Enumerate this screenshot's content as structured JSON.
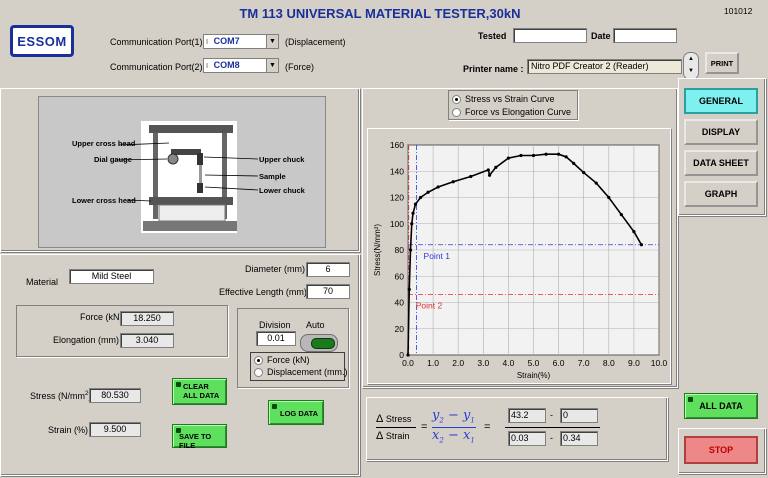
{
  "header": {
    "title": "TM 113 UNIVERSAL MATERIAL TESTER,30kN",
    "code": "101012",
    "logo_text": "ESSOM"
  },
  "ports": {
    "port1_label": "Communication Port(1)",
    "port1_value": "COM7",
    "port1_suffix": "(Displacement)",
    "port2_label": "Communication Port(2)",
    "port2_value": "COM8",
    "port2_suffix": "(Force)"
  },
  "meta": {
    "tested_label": "Tested",
    "tested_value": "",
    "date_label": "Date",
    "date_value": "",
    "printer_label": "Printer name :",
    "printer_value": "Nitro PDF Creator 2 (Reader)",
    "print_button": "PRINT"
  },
  "nav": {
    "general": "GENERAL",
    "display": "DISPLAY",
    "data_sheet": "DATA SHEET",
    "graph": "GRAPH",
    "all_data": "ALL DATA",
    "stop": "STOP"
  },
  "diagram": {
    "upper_cross_head": "Upper cross head",
    "dial_gauge": "Dial gauge",
    "upper_chuck": "Upper chuck",
    "sample": "Sample",
    "lower_chuck": "Lower chuck",
    "lower_cross_head": "Lower cross head"
  },
  "specimen": {
    "material_label": "Material",
    "material_value": "Mild Steel",
    "diameter_label": "Diameter (mm)",
    "diameter_value": "6",
    "length_label": "Effective Length (mm)",
    "length_value": "70"
  },
  "readings": {
    "force_label": "Force (kN)",
    "force_value": "18.250",
    "elongation_label": "Elongation (mm)",
    "elongation_value": "3.040",
    "stress_label": "Stress (N/mm",
    "stress_sup": "2",
    "stress_close": ")",
    "stress_value": "80.530",
    "strain_label": "Strain (%)",
    "strain_value": "9.500"
  },
  "controls": {
    "clear_all": "CLEAR ALL DATA",
    "save_file": "SAVE TO FILE",
    "log_data": "LOG DATA",
    "division_label": "Division",
    "division_value": "0.01",
    "auto_label": "Auto",
    "opt_force": "Force (kN)",
    "opt_disp": "Displacement (mm.)"
  },
  "curve_select": {
    "stress_strain": "Stress vs Strain Curve",
    "force_elong": "Force vs Elongation Curve"
  },
  "formula": {
    "d_stress": "Stress",
    "d_strain": "Strain",
    "delta": "Δ",
    "eq": "=",
    "x2": "x",
    "x1": "x",
    "y2": "y",
    "y1": "y",
    "sub2": "2",
    "sub1": "1",
    "minus": "−",
    "y2_value": "43.2",
    "y1_value": "0",
    "x2_value": "0.03",
    "x1_value": "0.34",
    "dash": "-"
  },
  "chart_data": {
    "type": "line",
    "xlabel": "Strain(%)",
    "ylabel": "Stress(N/mm²)",
    "xlim": [
      0,
      10
    ],
    "ylim": [
      0,
      160
    ],
    "x_ticks": [
      "0.0",
      "1.0",
      "2.0",
      "3.0",
      "4.0",
      "5.0",
      "6.0",
      "7.0",
      "8.0",
      "9.0",
      "10.0"
    ],
    "y_ticks": [
      "0",
      "20",
      "40",
      "60",
      "80",
      "100",
      "120",
      "140",
      "160"
    ],
    "grid": true,
    "series": [
      {
        "x": [
          0,
          0.05,
          0.1,
          0.15,
          0.2,
          0.3,
          0.5,
          0.8,
          1.2,
          1.8,
          2.5,
          3.2,
          3.25,
          3.5,
          4.0,
          4.5,
          5.0,
          5.5,
          6.0,
          6.3,
          6.6,
          7.0,
          7.5,
          8.0,
          8.5,
          9.0,
          9.3
        ],
        "y": [
          0,
          50,
          80,
          100,
          108,
          115,
          120,
          124,
          128,
          132,
          136,
          141,
          137,
          143,
          150,
          152,
          152,
          153,
          153,
          151,
          146,
          139,
          131,
          120,
          107,
          94,
          84
        ],
        "color": "#000000"
      }
    ],
    "markers": [
      {
        "label": "Point 1",
        "x": 0.34,
        "y": 84,
        "color": "#2b3bd8"
      },
      {
        "label": "Point 2",
        "x": 0.03,
        "y": 46,
        "color": "#e03030"
      }
    ]
  }
}
